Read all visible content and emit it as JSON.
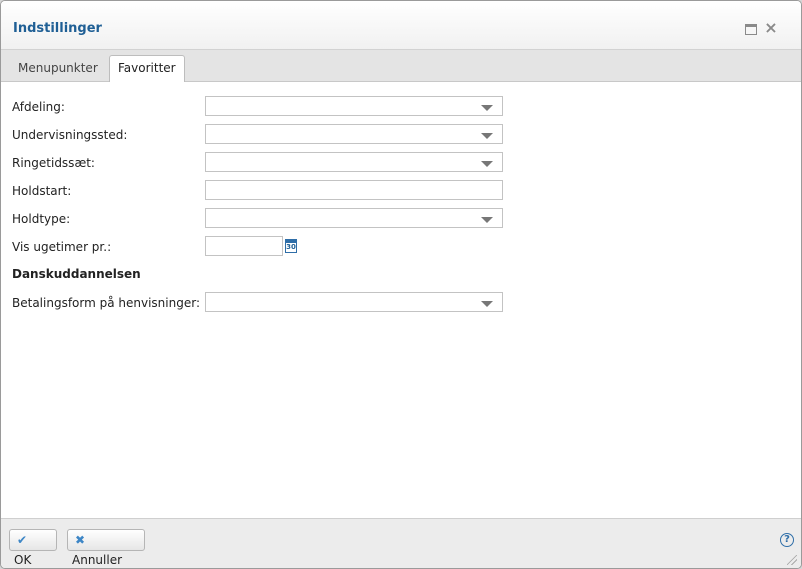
{
  "dialog": {
    "title": "Indstillinger"
  },
  "tabs": [
    {
      "label": "Menupunkter",
      "selected": false
    },
    {
      "label": "Favoritter",
      "selected": true
    }
  ],
  "form": {
    "afdeling": {
      "label": "Afdeling:",
      "value": ""
    },
    "undervisningssted": {
      "label": "Undervisningssted:",
      "value": ""
    },
    "ringetidssaet": {
      "label": "Ringetidssæt:",
      "value": ""
    },
    "holdstart": {
      "label": "Holdstart:",
      "value": ""
    },
    "holdtype": {
      "label": "Holdtype:",
      "value": ""
    },
    "vis_ugetimer": {
      "label": "Vis ugetimer pr.:",
      "value": ""
    },
    "section_heading": "Danskuddannelsen",
    "betalingsform": {
      "label": "Betalingsform på henvisninger:",
      "value": ""
    }
  },
  "calendar_icon": {
    "day": "30"
  },
  "footer": {
    "ok_label": "OK",
    "cancel_label": "Annuller",
    "help_glyph": "?"
  },
  "colors": {
    "title": "#1f5f95",
    "accent": "#3d86c6"
  }
}
